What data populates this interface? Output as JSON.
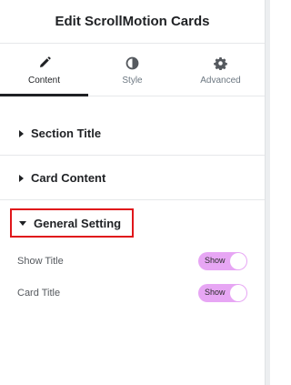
{
  "header": {
    "title": "Edit ScrollMotion Cards"
  },
  "tabs": [
    {
      "label": "Content",
      "icon": "pencil-icon",
      "active": true
    },
    {
      "label": "Style",
      "icon": "half-circle-icon",
      "active": false
    },
    {
      "label": "Advanced",
      "icon": "gear-icon",
      "active": false
    }
  ],
  "sections": [
    {
      "title": "Section Title",
      "expanded": false
    },
    {
      "title": "Card Content",
      "expanded": false
    },
    {
      "title": "General Setting",
      "expanded": true
    }
  ],
  "fields": [
    {
      "label": "Show Title",
      "toggle_text": "Show",
      "on": true
    },
    {
      "label": "Card Title",
      "toggle_text": "Show",
      "on": true
    }
  ],
  "colors": {
    "toggle_on": "#e7a6f4",
    "highlight_border": "#e0161b",
    "active_tab": "#1f2124"
  }
}
